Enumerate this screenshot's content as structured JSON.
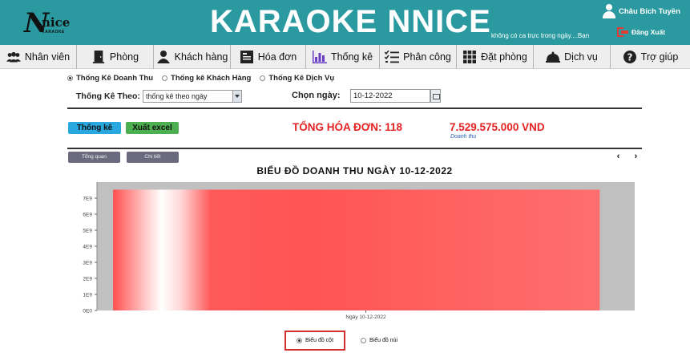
{
  "header": {
    "logo_initial": "N",
    "logo_text": "nice",
    "logo_sub": "KARAOKE",
    "title": "KARAOKE NNICE",
    "user_name": "Châu Bích Tuyền",
    "shift_notice": "không có ca trực trong ngày....Bạn",
    "logout_label": "Đăng Xuất"
  },
  "menu": [
    {
      "label": "Nhân viên",
      "icon": "users-icon"
    },
    {
      "label": "Phòng",
      "icon": "door-icon"
    },
    {
      "label": "Khách hàng",
      "icon": "customer-icon"
    },
    {
      "label": "Hóa đơn",
      "icon": "invoice-icon"
    },
    {
      "label": "Thống kê",
      "icon": "bar-chart-icon"
    },
    {
      "label": "Phân công",
      "icon": "task-list-icon"
    },
    {
      "label": "Đặt phòng",
      "icon": "grid-icon"
    },
    {
      "label": "Dịch vụ",
      "icon": "service-bell-icon"
    },
    {
      "label": "Trợ giúp",
      "icon": "help-icon"
    }
  ],
  "stat_types": [
    {
      "label": "Thống Kê Doanh Thu",
      "selected": true
    },
    {
      "label": "Thống kê Khách Hàng",
      "selected": false
    },
    {
      "label": "Thống Kê Dịch Vụ",
      "selected": false
    }
  ],
  "filter": {
    "label": "Thống Kê Theo:",
    "value": "thống kê theo ngày",
    "date_label": "Chọn ngày:",
    "date_value": "10-12-2022"
  },
  "actions": {
    "stat_button": "Thống kê",
    "excel_button": "Xuất excel"
  },
  "summary": {
    "total_invoices": "TỔNG HÓA ĐƠN: 118",
    "revenue": "7.529.575.000 VND",
    "revenue_label": "Doanh thu"
  },
  "tabs": {
    "overview": "Tổng quan",
    "detail": "Chi tiết",
    "prev": "‹",
    "next": "›"
  },
  "chart_data": {
    "type": "bar",
    "title": "BIỂU ĐỒ DOANH THU NGÀY 10-12-2022",
    "categories": [
      "Ngày 10-12-2022"
    ],
    "values": [
      7529575000
    ],
    "ylim": [
      0,
      7500000000
    ],
    "yticks": [
      0,
      1000000000,
      2000000000,
      3000000000,
      4000000000,
      5000000000,
      6000000000,
      7000000000
    ],
    "ytick_labels": [
      "0E0",
      "1E9",
      "2E9",
      "3E9",
      "4E9",
      "5E9",
      "6E9",
      "7E9"
    ],
    "bar_color": "#ff5c5c",
    "plot_background": "#c0c0c0",
    "grid": false,
    "xlabel": "",
    "ylabel": ""
  },
  "chart_types": [
    {
      "label": "Biểu đồ cột",
      "selected": true
    },
    {
      "label": "Biểu đồ núi",
      "selected": false
    }
  ]
}
